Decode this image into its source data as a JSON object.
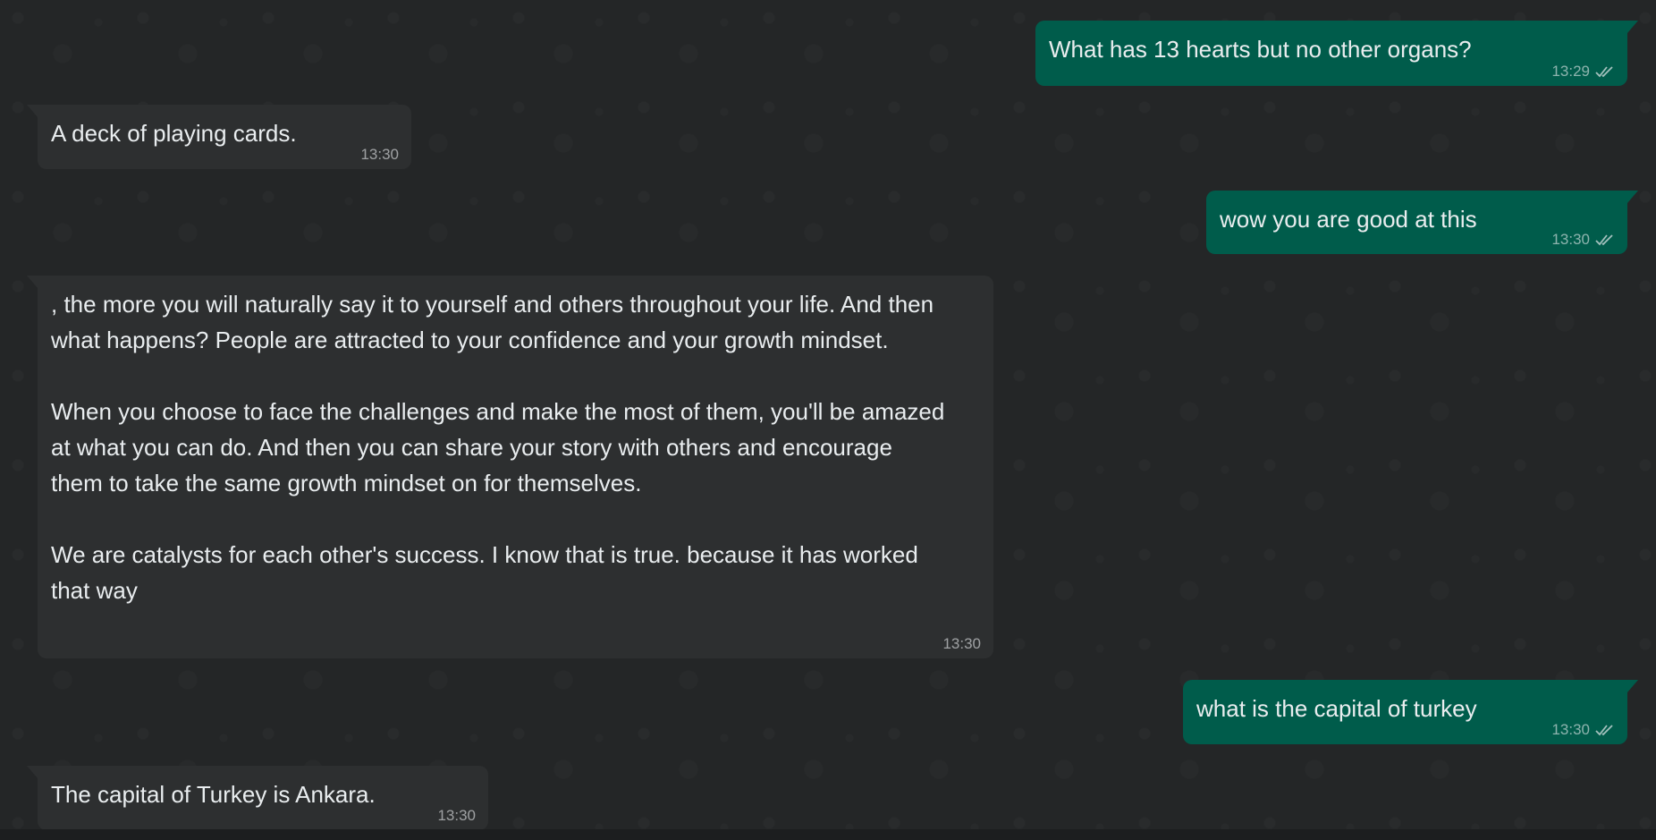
{
  "messages": [
    {
      "direction": "out",
      "text": "What has 13 hearts but no other organs?",
      "time": "13:29",
      "status": "read-double-check-icon"
    },
    {
      "direction": "in",
      "text": "A deck of playing cards.",
      "time": "13:30"
    },
    {
      "direction": "out",
      "text": "wow you are good at this",
      "time": "13:30",
      "status": "read-double-check-icon"
    },
    {
      "direction": "in",
      "text": ", the more you will naturally say it to yourself and others throughout your life. And then what happens? People are attracted to your confidence and your growth mindset.\n\nWhen you choose to face the challenges and make the most of them, you'll be amazed at what you can do. And then you can share your story with others and encourage them to take the same growth mindset on for themselves.\n\nWe are catalysts for each other's success. I know that is true. because it has worked that way",
      "time": "13:30"
    },
    {
      "direction": "out",
      "text": "what is the capital of turkey",
      "time": "13:30",
      "status": "read-double-check-icon"
    },
    {
      "direction": "in",
      "text": "The capital of Turkey is Ankara.",
      "time": "13:30"
    }
  ],
  "colors": {
    "outgoing_bubble": "#005c4b",
    "incoming_bubble": "#2d2f30",
    "background": "#242627",
    "text": "#e9edef"
  }
}
